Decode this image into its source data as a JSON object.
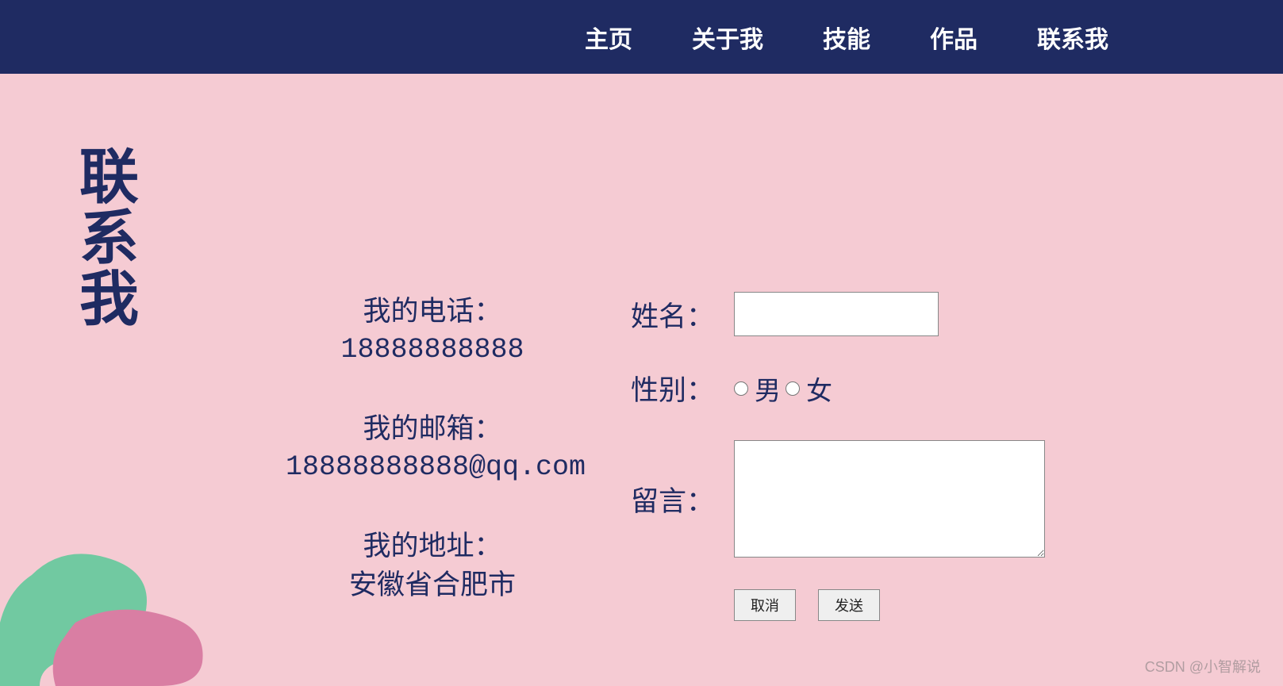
{
  "nav": {
    "items": [
      {
        "label": "主页"
      },
      {
        "label": "关于我"
      },
      {
        "label": "技能"
      },
      {
        "label": "作品"
      },
      {
        "label": "联系我"
      }
    ]
  },
  "section_title": "联系我",
  "contact": {
    "phone_label": "我的电话：",
    "phone_value": "18888888888",
    "email_label": "我的邮箱：",
    "email_value": "18888888888@qq.com",
    "address_label": "我的地址：",
    "address_value": "安徽省合肥市"
  },
  "form": {
    "name_label": "姓名：",
    "gender_label": "性别：",
    "gender_male": "男",
    "gender_female": "女",
    "message_label": "留言：",
    "cancel_button": "取消",
    "send_button": "发送"
  },
  "watermark": "CSDN @小智解说"
}
